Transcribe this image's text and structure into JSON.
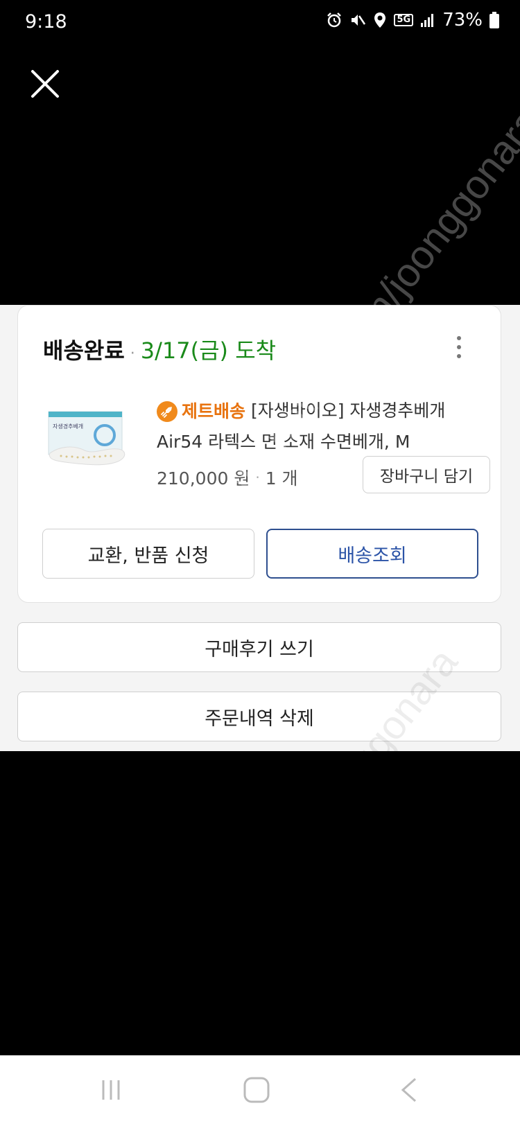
{
  "status_bar": {
    "time": "9:18",
    "network": "5G",
    "battery": "73%"
  },
  "order": {
    "status": "배송완료",
    "separator": "·",
    "arrival": "3/17(금) 도착",
    "jet_label": "제트배송",
    "product_title": "[자생바이오] 자생경추베개 Air54 라텍스 면 소재 수면베개, M",
    "price": "210,000 원",
    "qty_separator": "·",
    "quantity": "1 개",
    "thumb_box_text": "자생경추베개"
  },
  "buttons": {
    "cart": "장바구니 담기",
    "return": "교환, 반품 신청",
    "tracking": "배송조회",
    "review": "구매후기 쓰기",
    "delete": "주문내역 삭제"
  },
  "watermark": {
    "text": "cafe.naver.com/joonggonara"
  },
  "colors": {
    "arrival": "#1a8a1a",
    "jet": "#e8730f",
    "tracking": "#2b53a7"
  }
}
